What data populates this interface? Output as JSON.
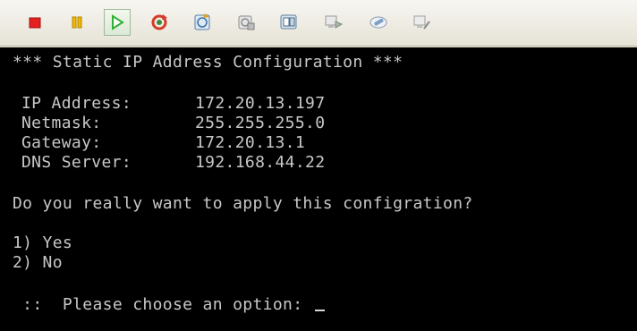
{
  "toolbar": {
    "buttons": [
      {
        "name": "stop-button",
        "icon": "stop-icon"
      },
      {
        "name": "pause-button",
        "icon": "pause-icon"
      },
      {
        "name": "play-button",
        "icon": "play-icon"
      },
      {
        "name": "reset-button",
        "icon": "reset-icon"
      },
      {
        "name": "snapshot-button",
        "icon": "snapshot-icon"
      },
      {
        "name": "revert-snapshot-button",
        "icon": "revert-snapshot-icon"
      },
      {
        "name": "snapshot-manager-button",
        "icon": "snapshot-manager-icon"
      },
      {
        "name": "connect-button",
        "icon": "network-connect-icon"
      },
      {
        "name": "tools-button",
        "icon": "tools-icon"
      },
      {
        "name": "disconnect-button",
        "icon": "network-disconnect-icon"
      }
    ]
  },
  "console": {
    "title": "*** Static IP Address Configuration ***",
    "fields": [
      {
        "label": "IP Address:",
        "value": "172.20.13.197"
      },
      {
        "label": "Netmask:",
        "value": "255.255.255.0"
      },
      {
        "label": "Gateway:",
        "value": "172.20.13.1"
      },
      {
        "label": "DNS Server:",
        "value": "192.168.44.22"
      }
    ],
    "question": "Do you really want to apply this configration?",
    "options": [
      "1) Yes",
      "2) No"
    ],
    "prompt": " ::  Please choose an option: "
  },
  "colors": {
    "console_bg": "#000000",
    "console_text": "#c8c8c8",
    "stop": "#e52020",
    "pause": "#f2b800",
    "play": "#2fb12f"
  }
}
